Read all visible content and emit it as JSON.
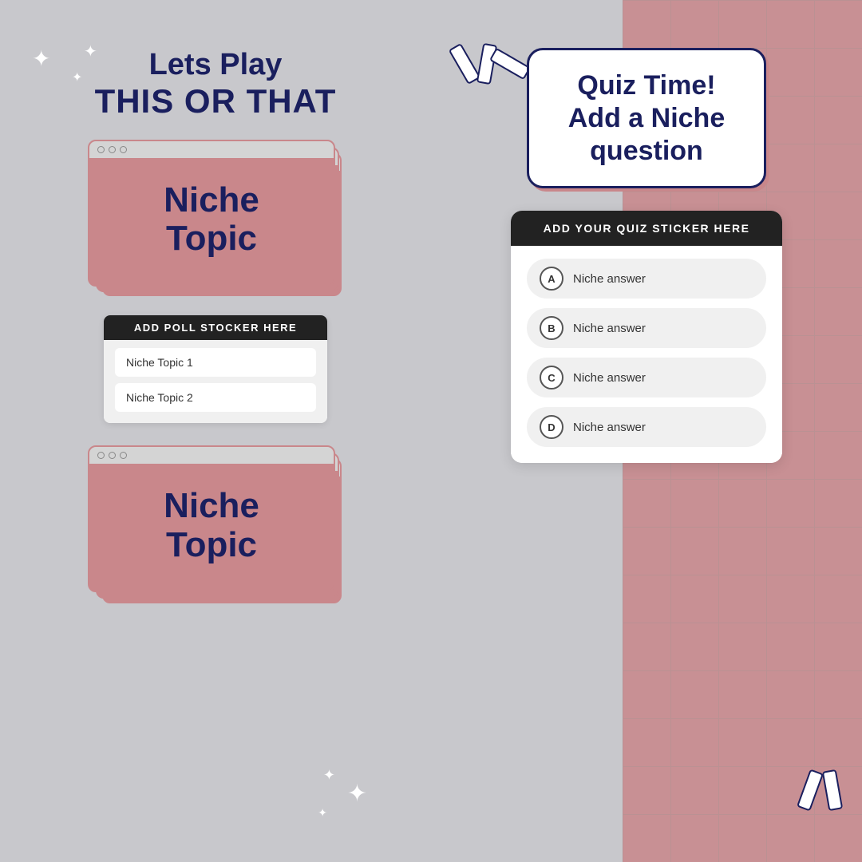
{
  "left": {
    "title_line1": "Lets Play",
    "title_line2": "THIS OR THAT",
    "card_top": {
      "text_line1": "Niche",
      "text_line2": "Topic"
    },
    "poll_header": "ADD POLL STOCKER HERE",
    "poll_option1": "Niche Topic 1",
    "poll_option2": "Niche Topic 2",
    "card_bottom": {
      "text_line1": "Niche",
      "text_line2": "Topic"
    }
  },
  "right": {
    "quiz_bubble_text": "Quiz Time! Add a Niche question",
    "quiz_header": "ADD YOUR QUIZ STICKER HERE",
    "answers": [
      {
        "letter": "A",
        "text": "Niche answer"
      },
      {
        "letter": "B",
        "text": "Niche answer"
      },
      {
        "letter": "C",
        "text": "Niche answer"
      },
      {
        "letter": "D",
        "text": "Niche answer"
      }
    ]
  },
  "colors": {
    "navy": "#1a1f5e",
    "mauve": "#c9878b",
    "light_gray": "#c8c8cc",
    "dark": "#222222",
    "white": "#ffffff"
  }
}
